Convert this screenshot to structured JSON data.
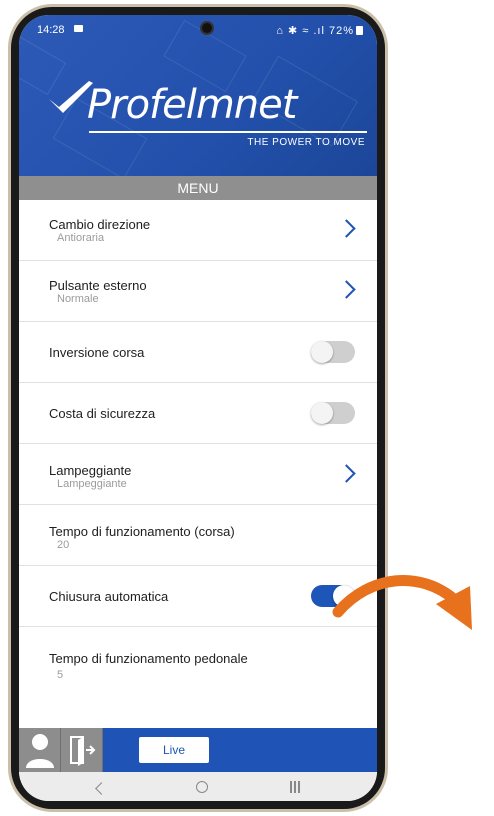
{
  "status_bar": {
    "time": "14:28",
    "right_text": "⌂ ✱ ≈ .ıl 72%"
  },
  "brand": {
    "name": "Profelmnet",
    "tagline": "THE POWER TO MOVE"
  },
  "menu": {
    "title": "MENU"
  },
  "items": [
    {
      "title": "Cambio direzione",
      "subtitle": "Antioraria",
      "control": "chevron"
    },
    {
      "title": "Pulsante esterno",
      "subtitle": "Normale",
      "control": "chevron"
    },
    {
      "title": "Inversione corsa",
      "subtitle": "",
      "control": "toggle",
      "on": false
    },
    {
      "title": "Costa di sicurezza",
      "subtitle": "",
      "control": "toggle",
      "on": false
    },
    {
      "title": "Lampeggiante",
      "subtitle": "Lampeggiante",
      "control": "chevron"
    },
    {
      "title": "Tempo di funzionamento (corsa)",
      "subtitle": "20",
      "control": "none"
    },
    {
      "title": "Chiusura automatica",
      "subtitle": "",
      "control": "toggle",
      "on": true
    },
    {
      "title": "Tempo di funzionamento pedonale",
      "subtitle": "5",
      "control": "none"
    }
  ],
  "bottom_bar": {
    "live_label": "Live",
    "user_icon": "user-icon",
    "logout_icon": "logout-icon"
  },
  "colors": {
    "brand_blue": "#1f53b5",
    "menu_gray": "#8f8f8f",
    "arrow_orange": "#e8711e"
  },
  "icons": {
    "nav_back": "back-icon",
    "nav_home": "home-icon",
    "nav_recents": "recents-icon",
    "annotation": "curved-arrow-icon"
  }
}
